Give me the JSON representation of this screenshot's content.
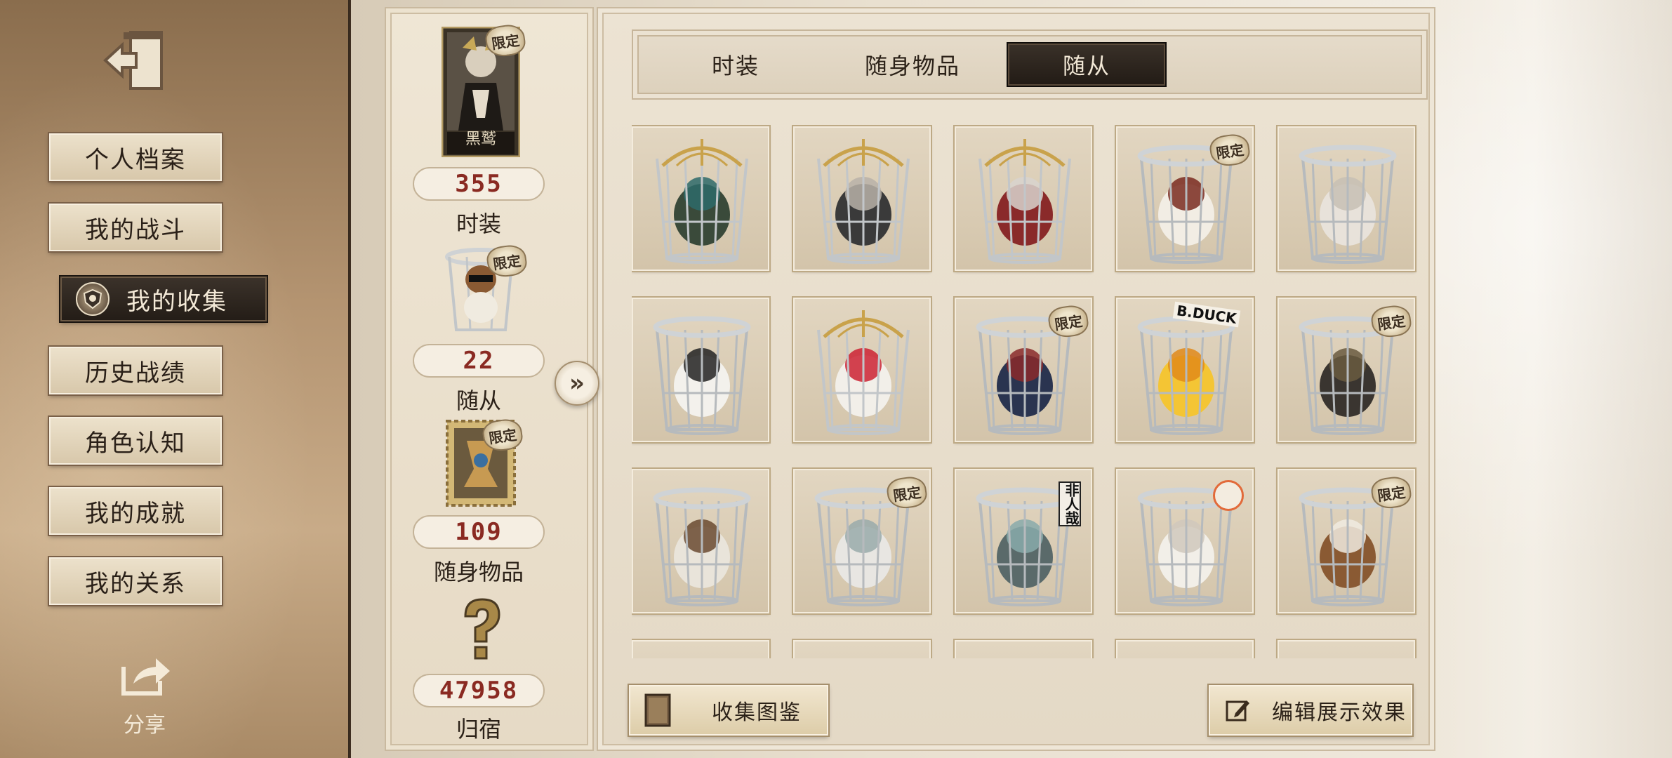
{
  "sidebar": {
    "items": [
      {
        "label": "个人档案"
      },
      {
        "label": "我的战斗"
      },
      {
        "label": "我的收集"
      },
      {
        "label": "历史战绩"
      },
      {
        "label": "角色认知"
      },
      {
        "label": "我的成就"
      },
      {
        "label": "我的关系"
      }
    ],
    "share_label": "分享"
  },
  "stats": {
    "costume": {
      "card_label": "黑鹫",
      "tag": "限定",
      "value": "355",
      "label": "时装"
    },
    "follower": {
      "tag": "限定",
      "value": "22",
      "label": "随从"
    },
    "accessory": {
      "tag": "限定",
      "value": "109",
      "label": "随身物品"
    },
    "home": {
      "value": "47958",
      "label": "归宿"
    }
  },
  "tabs": [
    {
      "label": "时装"
    },
    {
      "label": "随身物品"
    },
    {
      "label": "随从"
    }
  ],
  "grid": {
    "tag_text": "限定",
    "row3_sign": "非人哉",
    "row2_sign": "B.DUCK",
    "items": [
      {
        "name": "tree-spirit",
        "limited": false,
        "cage": "gold"
      },
      {
        "name": "machine-bot",
        "limited": false,
        "cage": "gold"
      },
      {
        "name": "red-doll",
        "limited": false,
        "cage": "gold"
      },
      {
        "name": "witch-bird",
        "limited": true,
        "cage": "silver"
      },
      {
        "name": "elephant",
        "limited": false,
        "cage": "silver"
      },
      {
        "name": "panda",
        "limited": false,
        "cage": "silver"
      },
      {
        "name": "white-fox",
        "limited": false,
        "cage": "gold"
      },
      {
        "name": "eyeball",
        "limited": true,
        "cage": "silver"
      },
      {
        "name": "yellow-duck",
        "limited": false,
        "cage": "silver"
      },
      {
        "name": "black-cat",
        "limited": true,
        "cage": "silver"
      },
      {
        "name": "king-cat",
        "limited": false,
        "cage": "silver"
      },
      {
        "name": "white-spirit",
        "limited": true,
        "cage": "silver"
      },
      {
        "name": "grey-monster",
        "limited": false,
        "cage": "silver"
      },
      {
        "name": "white-birds",
        "limited": false,
        "cage": "silver"
      },
      {
        "name": "beagle-dog",
        "limited": true,
        "cage": "silver"
      }
    ]
  },
  "buttons": {
    "catalog": "收集图鉴",
    "edit_display": "编辑展示效果"
  },
  "colors": {
    "accent_value": "#8a2a22",
    "active_tab_bg": "#2a221b",
    "paper": "#e9e0d0"
  }
}
